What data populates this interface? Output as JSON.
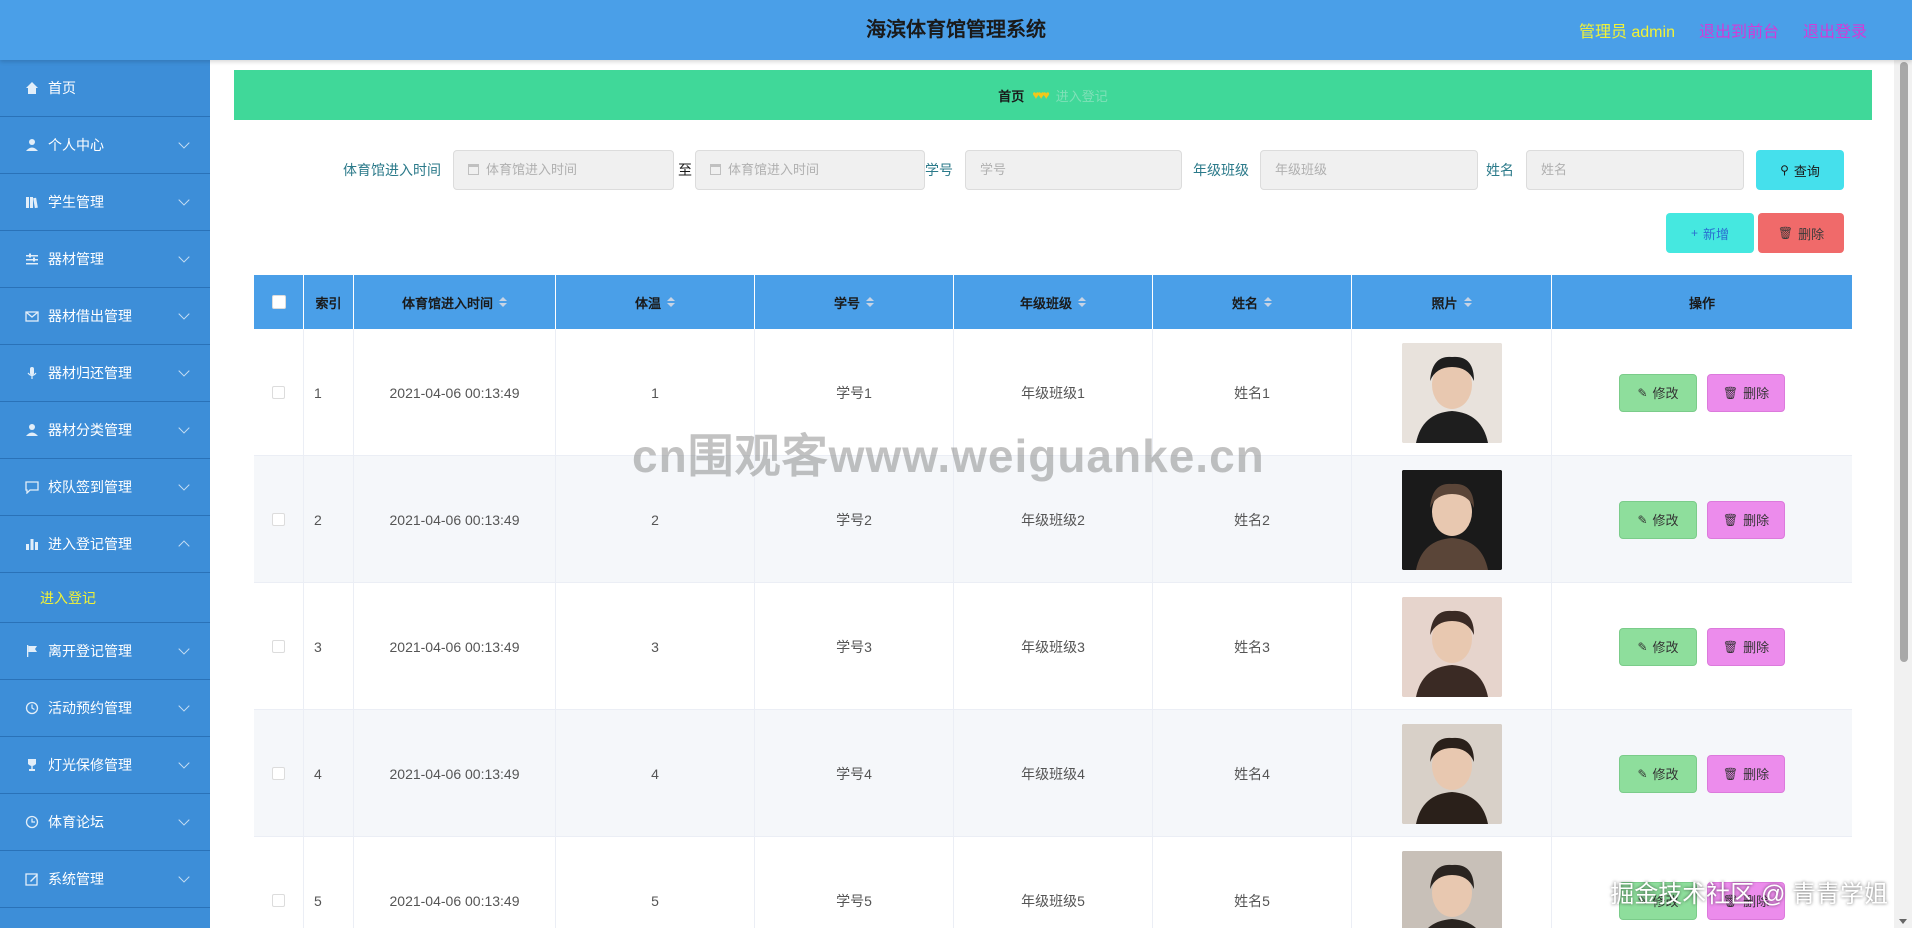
{
  "header": {
    "title": "海滨体育馆管理系统",
    "admin_label": "管理员 admin",
    "back_label": "退出到前台",
    "logout_label": "退出登录"
  },
  "sidebar": {
    "items": [
      {
        "label": "首页",
        "icon": "home-icon"
      },
      {
        "label": "个人中心",
        "icon": "user-icon"
      },
      {
        "label": "学生管理",
        "icon": "book-icon"
      },
      {
        "label": "器材管理",
        "icon": "sliders-icon"
      },
      {
        "label": "器材借出管理",
        "icon": "mail-icon"
      },
      {
        "label": "器材归还管理",
        "icon": "mic-icon"
      },
      {
        "label": "器材分类管理",
        "icon": "user-icon"
      },
      {
        "label": "校队签到管理",
        "icon": "chat-icon"
      },
      {
        "label": "进入登记管理",
        "icon": "chart-icon"
      },
      {
        "label": "离开登记管理",
        "icon": "flag-icon"
      },
      {
        "label": "活动预约管理",
        "icon": "clock-icon"
      },
      {
        "label": "灯光保修管理",
        "icon": "trophy-icon"
      },
      {
        "label": "体育论坛",
        "icon": "time-icon"
      },
      {
        "label": "系统管理",
        "icon": "edit-icon"
      }
    ],
    "submenu_label": "进入登记"
  },
  "breadcrumb": {
    "home": "首页",
    "hearts": "♥♥♥",
    "current": "进入登记"
  },
  "search": {
    "time_label": "体育馆进入时间",
    "time_start_placeholder": "体育馆进入时间",
    "to_label": "至",
    "time_end_placeholder": "体育馆进入时间",
    "student_no_label": "学号",
    "student_no_placeholder": "学号",
    "class_label": "年级班级",
    "class_placeholder": "年级班级",
    "name_label": "姓名",
    "name_placeholder": "姓名",
    "query_label": "查询"
  },
  "actions": {
    "add_label": "新增",
    "delete_label": "删除"
  },
  "table": {
    "headers": [
      "索引",
      "体育馆进入时间",
      "体温",
      "学号",
      "年级班级",
      "姓名",
      "照片",
      "操作"
    ],
    "edit_label": "修改",
    "delete_label": "删除",
    "rows": [
      {
        "index": "1",
        "time": "2021-04-06 00:13:49",
        "temp": "1",
        "student_no": "学号1",
        "class": "年级班级1",
        "name": "姓名1",
        "photo_bg": "#e8e2dc",
        "photo_fg": "#1e1e1e"
      },
      {
        "index": "2",
        "time": "2021-04-06 00:13:49",
        "temp": "2",
        "student_no": "学号2",
        "class": "年级班级2",
        "name": "姓名2",
        "photo_bg": "#1a1a1a",
        "photo_fg": "#5a4538"
      },
      {
        "index": "3",
        "time": "2021-04-06 00:13:49",
        "temp": "3",
        "student_no": "学号3",
        "class": "年级班级3",
        "name": "姓名3",
        "photo_bg": "#e6d4cc",
        "photo_fg": "#3a2a24"
      },
      {
        "index": "4",
        "time": "2021-04-06 00:13:49",
        "temp": "4",
        "student_no": "学号4",
        "class": "年级班级4",
        "name": "姓名4",
        "photo_bg": "#d8d0c8",
        "photo_fg": "#2a201a"
      },
      {
        "index": "5",
        "time": "2021-04-06 00:13:49",
        "temp": "5",
        "student_no": "学号5",
        "class": "年级班级5",
        "name": "姓名5",
        "photo_bg": "#c8c0b8",
        "photo_fg": "#2a2420"
      }
    ]
  },
  "watermark": {
    "center": "cn围观客www.weiguanke.cn",
    "corner": "掘金技术社区 @ 青青学姐"
  }
}
